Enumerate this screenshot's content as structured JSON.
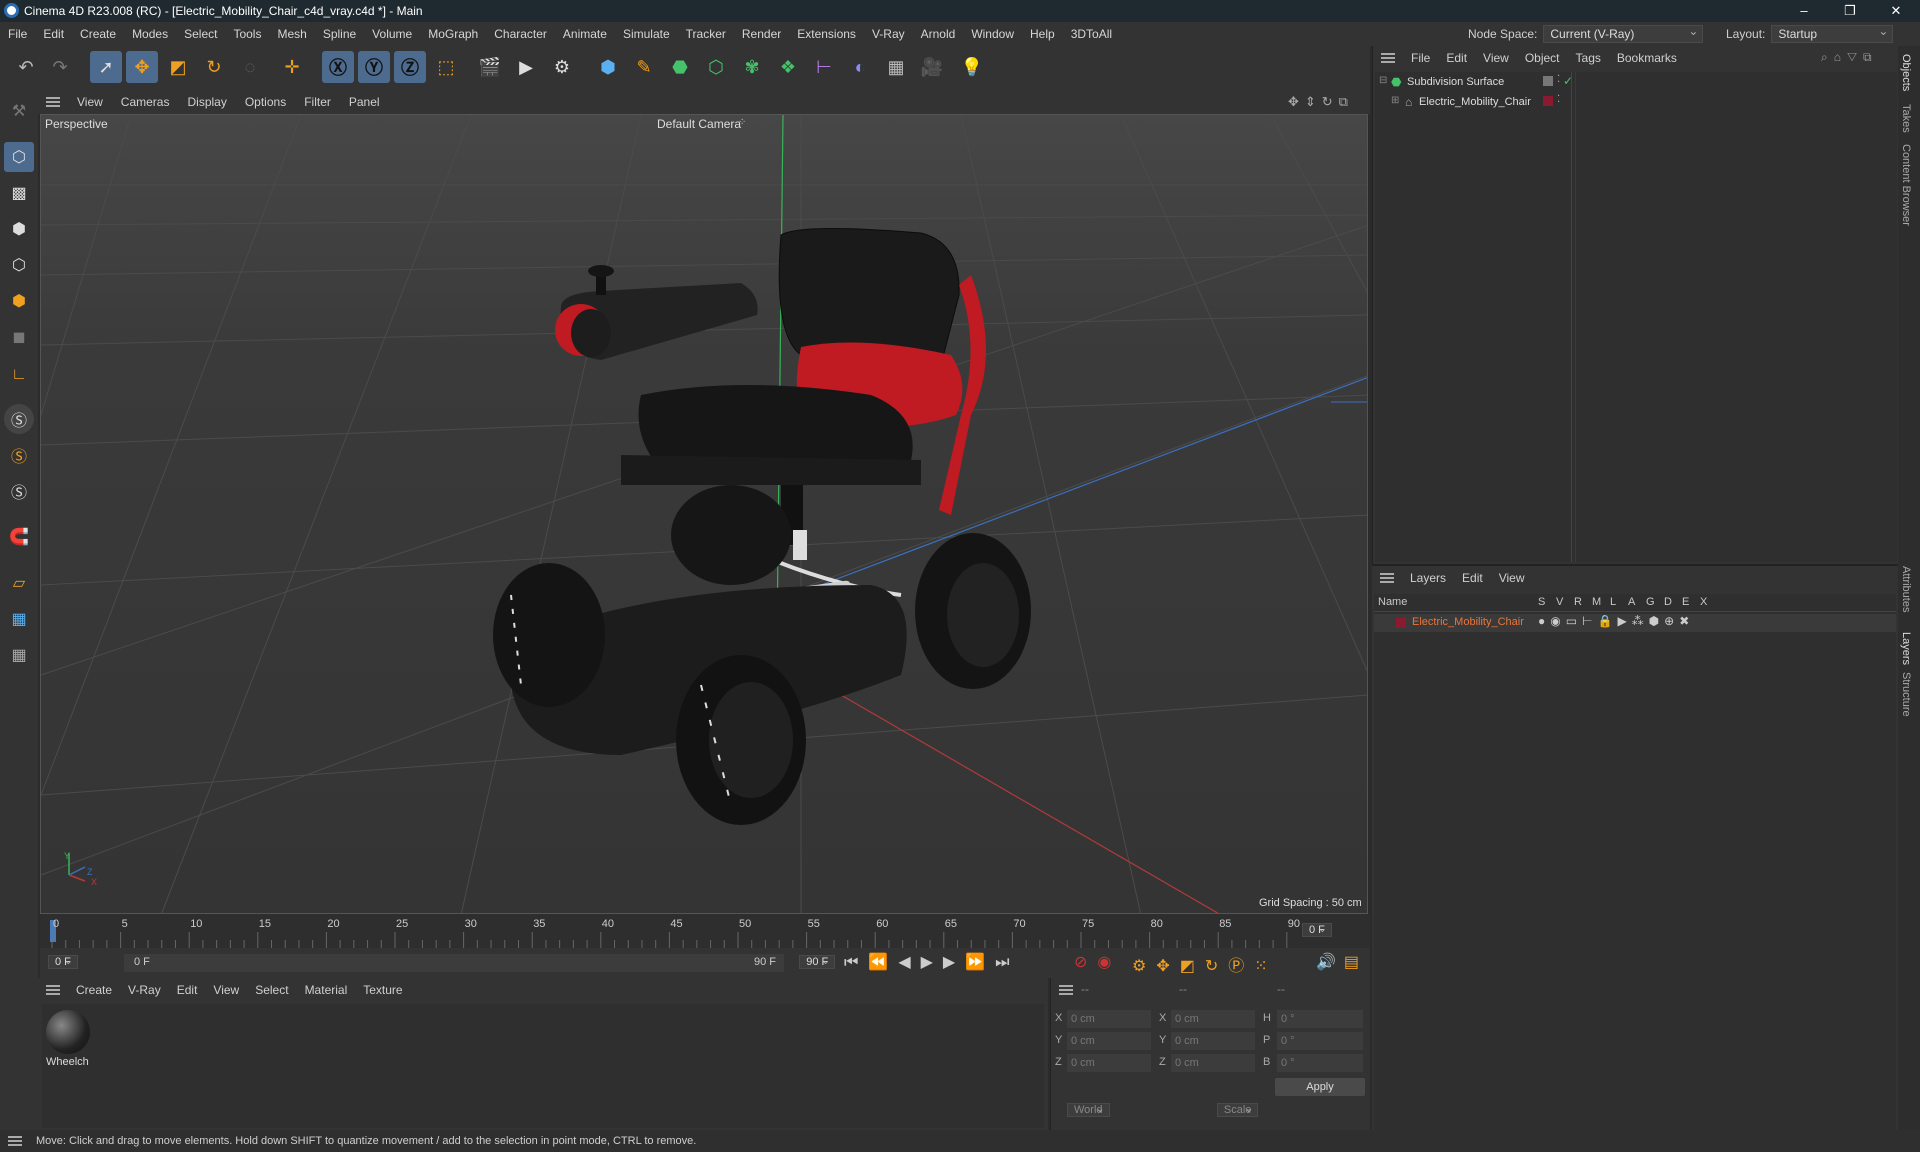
{
  "window": {
    "title": "Cinema 4D R23.008 (RC) - [Electric_Mobility_Chair_c4d_vray.c4d *] - Main",
    "minimize": "–",
    "restore": "❐",
    "close": "✕"
  },
  "menu": [
    "File",
    "Edit",
    "Create",
    "Modes",
    "Select",
    "Tools",
    "Mesh",
    "Spline",
    "Volume",
    "MoGraph",
    "Character",
    "Animate",
    "Simulate",
    "Tracker",
    "Render",
    "Extensions",
    "V-Ray",
    "Arnold",
    "Window",
    "Help",
    "3DToAll"
  ],
  "nodespace": {
    "label": "Node Space:",
    "value": "Current (V-Ray)"
  },
  "layout": {
    "label": "Layout:",
    "value": "Startup"
  },
  "viewport_menu": [
    "View",
    "Cameras",
    "Display",
    "Options",
    "Filter",
    "Panel"
  ],
  "viewport": {
    "name": "Perspective",
    "camera": "Default Camera",
    "camera_icon": "camera-dots-icon",
    "grid_spacing": "Grid Spacing : 50 cm",
    "axis_y": "Y",
    "axis_z": "Z",
    "axis_x": "X"
  },
  "timeline": {
    "ticks": [
      "0",
      "5",
      "10",
      "15",
      "20",
      "25",
      "30",
      "35",
      "40",
      "45",
      "50",
      "55",
      "60",
      "65",
      "70",
      "75",
      "80",
      "85",
      "90"
    ],
    "current": "0 F"
  },
  "transport": {
    "start": "0 F",
    "range_start": "0 F",
    "range_end": "90 F",
    "end": "90 F"
  },
  "material_menu": [
    "Create",
    "V-Ray",
    "Edit",
    "View",
    "Select",
    "Material",
    "Texture"
  ],
  "materials": [
    {
      "name": "Wheelch"
    }
  ],
  "coords": {
    "header": [
      "--",
      "--",
      "--"
    ],
    "rows": [
      {
        "a": "X",
        "v1": "0 cm",
        "b": "X",
        "v2": "0 cm",
        "c": "H",
        "v3": "0 °"
      },
      {
        "a": "Y",
        "v1": "0 cm",
        "b": "Y",
        "v2": "0 cm",
        "c": "P",
        "v3": "0 °"
      },
      {
        "a": "Z",
        "v1": "0 cm",
        "b": "Z",
        "v2": "0 cm",
        "c": "B",
        "v3": "0 °"
      }
    ],
    "world": "World",
    "scale": "Scale",
    "apply": "Apply"
  },
  "objects_menu": [
    "File",
    "Edit",
    "View",
    "Object",
    "Tags",
    "Bookmarks"
  ],
  "objects": [
    {
      "name": "Subdivision Surface",
      "color": "#46c36a"
    },
    {
      "name": "Electric_Mobility_Chair",
      "color": "#8a1a30"
    }
  ],
  "layers_menu": [
    "Layers",
    "Edit",
    "View"
  ],
  "layers_header": {
    "name": "Name",
    "cols": [
      "S",
      "V",
      "R",
      "M",
      "L",
      "A",
      "G",
      "D",
      "E",
      "X"
    ]
  },
  "layers": [
    {
      "name": "Electric_Mobility_Chair",
      "color": "#8a1a30"
    }
  ],
  "side_tabs": [
    "Objects",
    "Takes",
    "Content Browser",
    "Attributes",
    "Layers",
    "Structure"
  ],
  "status": "Move: Click and drag to move elements. Hold down SHIFT to quantize movement / add to the selection in point mode, CTRL to remove."
}
